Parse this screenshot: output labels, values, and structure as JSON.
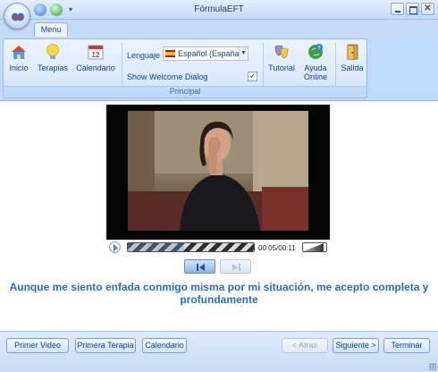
{
  "window": {
    "title": "FórmulaEFT"
  },
  "ribbon": {
    "tab": "Menu",
    "group_label": "Principal",
    "buttons": {
      "inicio": "Inicio",
      "terapias": "Terapias",
      "calendario": "Calendario",
      "tutorial": "Tutorial",
      "ayuda_line1": "Ayuda",
      "ayuda_line2": "Online",
      "salida": "Salida"
    },
    "language": {
      "label": "Lenguaje",
      "value": "Español (España, t"
    },
    "welcome": {
      "label": "Show Welcome Dialog",
      "checked": true,
      "mark": "✓"
    }
  },
  "player": {
    "time": "00:05/00:11",
    "progress": 0.45,
    "volume": 0.9
  },
  "caption": "Aunque me siento enfada conmigo misma por mi situación, me acepto completa y profundamente",
  "bottom": {
    "primer_video": "Primer Video",
    "primera_terapia": "Primera Terapia",
    "calendario": "Calendario",
    "atras": "< Atras",
    "siguiente": "Siguiente >",
    "terminar": "Terminar"
  },
  "icons": {
    "inicio": "house-icon",
    "terapias": "lightbulb-icon",
    "calendario": "calendar-icon",
    "tutorial": "masks-icon",
    "ayuda": "help-globe-icon",
    "salida": "exit-door-icon"
  }
}
